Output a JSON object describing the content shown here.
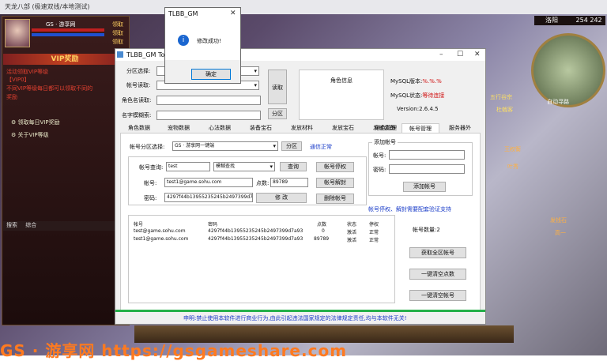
{
  "game": {
    "window_title": "天龙八部 (极速双线/本地测试)",
    "char_name": "GS · 游享网",
    "side_buttons": [
      "领取",
      "领取",
      "领取"
    ],
    "vip_banner": "VIP奖励",
    "vip_header": "活动领取VIP等级",
    "vip_notice": [
      "【VIP0】",
      "不同VIP等级每日都可以领取不同的",
      "奖励"
    ],
    "vip_btn1": "领取每日VIP奖励",
    "vip_btn2": "关于VIP等级",
    "chat_tabs": [
      "搜索",
      "综合"
    ],
    "map_name": "洛阳",
    "map_coords": "254 242",
    "map_labels": [
      "自动寻路"
    ],
    "watermark": "GS · 游享网 https://gsgameshare.com",
    "scene_labels": [
      "五行谷宗",
      "杜戟客",
      "王权衡",
      "叶秀",
      "发钱石",
      "高一"
    ]
  },
  "tool": {
    "title": "TLBB_GM Too",
    "labels": {
      "server_select": "分区选择:",
      "account_read": "帐号读取:",
      "role_name_read": "角色名读取:",
      "fuzzy_name": "名字模糊索:"
    },
    "buttons": {
      "read": "读取",
      "partition": "分区"
    },
    "role_info_title": "角色信息",
    "mysql_version_label": "MySQL版本:",
    "mysql_version_value": "%.%.%",
    "mysql_status_label": "MySQL状态:",
    "mysql_status_value": "等待连接",
    "version": "Version:2.6.4.5",
    "tabs": [
      "角色数据",
      "宠物数据",
      "心法数据",
      "装备宝石",
      "发放材料",
      "发放宝石",
      "发放装备",
      "角色管理",
      "帐号管理",
      "服务器外"
    ],
    "active_tab": "帐号管理",
    "account_panel": {
      "server_label": "帐号分区选择:",
      "server_value": "GS · 游享网一键端",
      "partition_btn": "分区",
      "comm_status": "通信正常",
      "query_label": "帐号查询:",
      "query_value": "test",
      "fuzzy_select": "模糊查找",
      "query_btn": "查询",
      "account_label": "帐号:",
      "account_value": "test1@game.sohu.com",
      "points_label": "点数:",
      "points_value": "89789",
      "password_label": "密码:",
      "password_value": "4297f44b13955235245b2497399d7a93",
      "modify_btn": "修 改",
      "ban_btn": "帐号停权",
      "unban_btn": "帐号解封",
      "delete_btn": "删除帐号",
      "add_group_title": "添加帐号",
      "add_account_label": "帐号:",
      "add_password_label": "密码:",
      "add_btn": "添加帐号",
      "notice": "帐号停权、解封需要配套验证支持",
      "table_headers": [
        "帐号",
        "密码",
        "点数",
        "状态",
        "停权"
      ],
      "table_rows": [
        [
          "test@game.sohu.com",
          "4297f44b13955235245b2497399d7a93",
          "0",
          "激活",
          "正常"
        ],
        [
          "test1@game.sohu.com",
          "4297f44b13955235245b2497399d7a93",
          "89789",
          "激活",
          "正常"
        ]
      ],
      "count_label": "帐号数量:",
      "count_value": "2",
      "get_all_btn": "获取全区帐号",
      "clear_points_btn": "一键清空点数",
      "clear_accounts_btn": "一键清空帐号"
    },
    "footer_notice": "申明:禁止使用本软件进行商业行为,由此引起违法国家规定的法律规定责任,均与本软件无关!"
  },
  "msgbox": {
    "title": "TLBB_GM",
    "message": "修改成功!",
    "ok": "确定"
  }
}
